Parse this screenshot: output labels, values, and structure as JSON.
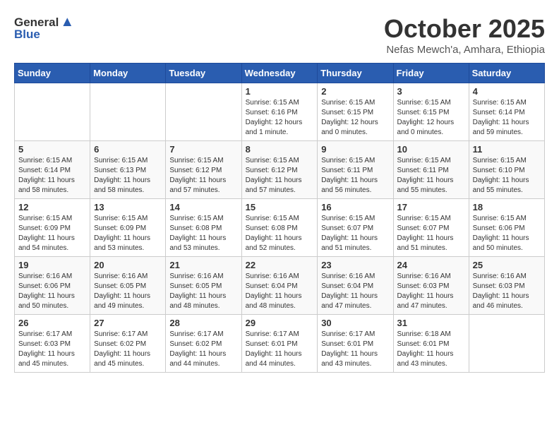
{
  "logo": {
    "general": "General",
    "blue": "Blue"
  },
  "header": {
    "month": "October 2025",
    "location": "Nefas Mewch'a, Amhara, Ethiopia"
  },
  "weekdays": [
    "Sunday",
    "Monday",
    "Tuesday",
    "Wednesday",
    "Thursday",
    "Friday",
    "Saturday"
  ],
  "weeks": [
    [
      {
        "day": "",
        "info": ""
      },
      {
        "day": "",
        "info": ""
      },
      {
        "day": "",
        "info": ""
      },
      {
        "day": "1",
        "info": "Sunrise: 6:15 AM\nSunset: 6:16 PM\nDaylight: 12 hours\nand 1 minute."
      },
      {
        "day": "2",
        "info": "Sunrise: 6:15 AM\nSunset: 6:15 PM\nDaylight: 12 hours\nand 0 minutes."
      },
      {
        "day": "3",
        "info": "Sunrise: 6:15 AM\nSunset: 6:15 PM\nDaylight: 12 hours\nand 0 minutes."
      },
      {
        "day": "4",
        "info": "Sunrise: 6:15 AM\nSunset: 6:14 PM\nDaylight: 11 hours\nand 59 minutes."
      }
    ],
    [
      {
        "day": "5",
        "info": "Sunrise: 6:15 AM\nSunset: 6:14 PM\nDaylight: 11 hours\nand 58 minutes."
      },
      {
        "day": "6",
        "info": "Sunrise: 6:15 AM\nSunset: 6:13 PM\nDaylight: 11 hours\nand 58 minutes."
      },
      {
        "day": "7",
        "info": "Sunrise: 6:15 AM\nSunset: 6:12 PM\nDaylight: 11 hours\nand 57 minutes."
      },
      {
        "day": "8",
        "info": "Sunrise: 6:15 AM\nSunset: 6:12 PM\nDaylight: 11 hours\nand 57 minutes."
      },
      {
        "day": "9",
        "info": "Sunrise: 6:15 AM\nSunset: 6:11 PM\nDaylight: 11 hours\nand 56 minutes."
      },
      {
        "day": "10",
        "info": "Sunrise: 6:15 AM\nSunset: 6:11 PM\nDaylight: 11 hours\nand 55 minutes."
      },
      {
        "day": "11",
        "info": "Sunrise: 6:15 AM\nSunset: 6:10 PM\nDaylight: 11 hours\nand 55 minutes."
      }
    ],
    [
      {
        "day": "12",
        "info": "Sunrise: 6:15 AM\nSunset: 6:09 PM\nDaylight: 11 hours\nand 54 minutes."
      },
      {
        "day": "13",
        "info": "Sunrise: 6:15 AM\nSunset: 6:09 PM\nDaylight: 11 hours\nand 53 minutes."
      },
      {
        "day": "14",
        "info": "Sunrise: 6:15 AM\nSunset: 6:08 PM\nDaylight: 11 hours\nand 53 minutes."
      },
      {
        "day": "15",
        "info": "Sunrise: 6:15 AM\nSunset: 6:08 PM\nDaylight: 11 hours\nand 52 minutes."
      },
      {
        "day": "16",
        "info": "Sunrise: 6:15 AM\nSunset: 6:07 PM\nDaylight: 11 hours\nand 51 minutes."
      },
      {
        "day": "17",
        "info": "Sunrise: 6:15 AM\nSunset: 6:07 PM\nDaylight: 11 hours\nand 51 minutes."
      },
      {
        "day": "18",
        "info": "Sunrise: 6:15 AM\nSunset: 6:06 PM\nDaylight: 11 hours\nand 50 minutes."
      }
    ],
    [
      {
        "day": "19",
        "info": "Sunrise: 6:16 AM\nSunset: 6:06 PM\nDaylight: 11 hours\nand 50 minutes."
      },
      {
        "day": "20",
        "info": "Sunrise: 6:16 AM\nSunset: 6:05 PM\nDaylight: 11 hours\nand 49 minutes."
      },
      {
        "day": "21",
        "info": "Sunrise: 6:16 AM\nSunset: 6:05 PM\nDaylight: 11 hours\nand 48 minutes."
      },
      {
        "day": "22",
        "info": "Sunrise: 6:16 AM\nSunset: 6:04 PM\nDaylight: 11 hours\nand 48 minutes."
      },
      {
        "day": "23",
        "info": "Sunrise: 6:16 AM\nSunset: 6:04 PM\nDaylight: 11 hours\nand 47 minutes."
      },
      {
        "day": "24",
        "info": "Sunrise: 6:16 AM\nSunset: 6:03 PM\nDaylight: 11 hours\nand 47 minutes."
      },
      {
        "day": "25",
        "info": "Sunrise: 6:16 AM\nSunset: 6:03 PM\nDaylight: 11 hours\nand 46 minutes."
      }
    ],
    [
      {
        "day": "26",
        "info": "Sunrise: 6:17 AM\nSunset: 6:03 PM\nDaylight: 11 hours\nand 45 minutes."
      },
      {
        "day": "27",
        "info": "Sunrise: 6:17 AM\nSunset: 6:02 PM\nDaylight: 11 hours\nand 45 minutes."
      },
      {
        "day": "28",
        "info": "Sunrise: 6:17 AM\nSunset: 6:02 PM\nDaylight: 11 hours\nand 44 minutes."
      },
      {
        "day": "29",
        "info": "Sunrise: 6:17 AM\nSunset: 6:01 PM\nDaylight: 11 hours\nand 44 minutes."
      },
      {
        "day": "30",
        "info": "Sunrise: 6:17 AM\nSunset: 6:01 PM\nDaylight: 11 hours\nand 43 minutes."
      },
      {
        "day": "31",
        "info": "Sunrise: 6:18 AM\nSunset: 6:01 PM\nDaylight: 11 hours\nand 43 minutes."
      },
      {
        "day": "",
        "info": ""
      }
    ]
  ]
}
